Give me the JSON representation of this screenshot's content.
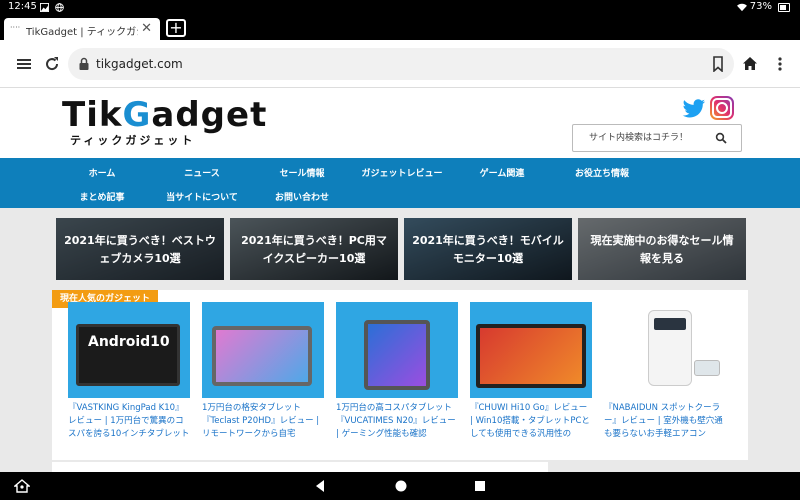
{
  "status": {
    "time": "12:45",
    "battery": "73%"
  },
  "tab": {
    "title": "TikGadget | ティックガジェ",
    "favicon": "····",
    "close": "✕",
    "new_tab": "+"
  },
  "toolbar": {
    "url": "tikgadget.com"
  },
  "site": {
    "logo_main_a": "Tik",
    "logo_main_b": "G",
    "logo_main_c": "adget",
    "logo_sub": "ティックガジェット",
    "search_placeholder": "サイト内検索はコチラ！"
  },
  "nav": {
    "items": [
      "ホーム",
      "ニュース",
      "セール情報",
      "ガジェットレビュー",
      "ゲーム関連",
      "お役立ち情報",
      "まとめ記事",
      "当サイトについて",
      "お問い合わせ"
    ]
  },
  "banners": [
    {
      "label": "2021年に買うべき！ベストウェブカメラ10選"
    },
    {
      "label": "2021年に買うべき！PC用マイクスピーカー10選"
    },
    {
      "label": "2021年に買うべき！モバイルモニター10選"
    },
    {
      "label": "現在実施中のお得なセール情報を見る"
    }
  ],
  "popular": {
    "ribbon": "現在人気のガジェット",
    "cards": [
      {
        "caption": "『VASTKING KingPad K10』レビュー | 1万円台で驚異のコスパを誇る10インチタブレット",
        "img_text": "Android10"
      },
      {
        "caption": "1万円台の格安タブレット『Teclast P20HD』レビュー | リモートワークから自宅",
        "img_text": ""
      },
      {
        "caption": "1万円台の高コスパタブレット『VUCATIMES N20』レビュー | ゲーミング性能も確認",
        "img_text": ""
      },
      {
        "caption": "『CHUWI Hi10 Go』レビュー | Win10搭載・タブレットPCとしても使用できる汎用性の",
        "img_text": ""
      },
      {
        "caption": "『NABAIDUN スポットクーラー』レビュー | 室外機も壁穴通も要らないお手軽エアコン",
        "img_text": ""
      }
    ]
  }
}
